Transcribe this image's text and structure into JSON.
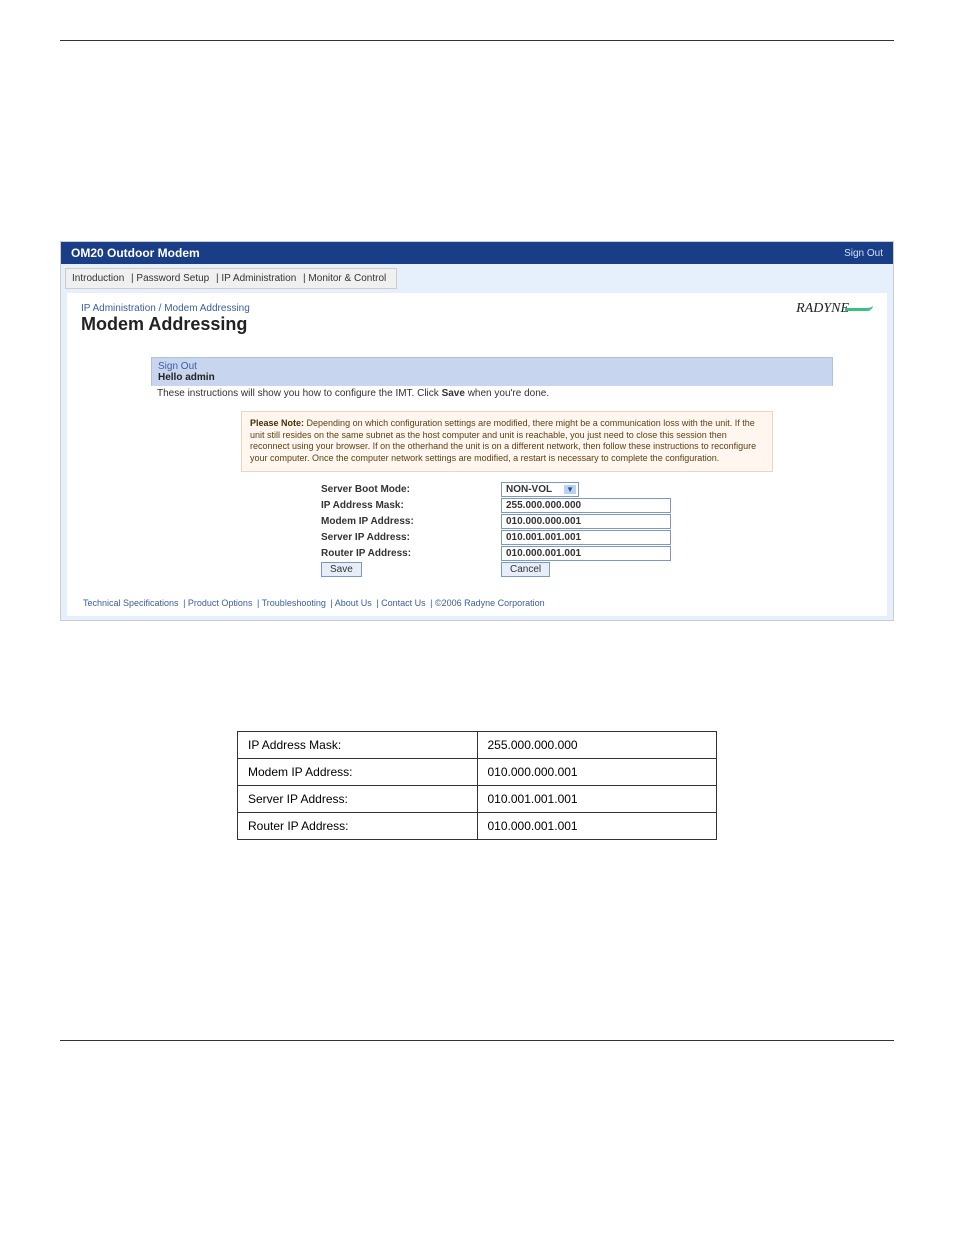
{
  "ss": {
    "title": "OM20 Outdoor Modem",
    "signout_top": "Sign Out",
    "menu": {
      "intro": "Introduction",
      "pw": "Password Setup",
      "ipadmin": "IP Administration",
      "mc": "Monitor & Control"
    },
    "breadcrumb": "IP Administration / Modem Addressing",
    "heading": "Modem Addressing",
    "logo": "RADYNE",
    "signout": "Sign Out",
    "hello": "Hello admin",
    "instructions_pre": "These instructions will show you how to configure the IMT. Click ",
    "instructions_bold": "Save",
    "instructions_post": " when you're done.",
    "note_label": "Please Note:",
    "note_body": " Depending on which configuration settings are modified, there might be a communication loss with the unit. If the unit still resides on the same subnet as the host computer and unit is reachable, you just need to close this session then reconnect using your browser. If on the otherhand the unit is on a different network, then follow these instructions to reconfigure your computer. Once the computer network settings are modified, a restart is necessary to complete the configuration.",
    "labels": {
      "boot": "Server Boot Mode:",
      "mask": "IP Address Mask:",
      "modem": "Modem IP Address:",
      "server": "Server IP Address:",
      "router": "Router IP Address:"
    },
    "values": {
      "boot": "NON-VOL",
      "mask": "255.000.000.000",
      "modem": "010.000.000.001",
      "server": "010.001.001.001",
      "router": "010.000.001.001"
    },
    "buttons": {
      "save": "Save",
      "cancel": "Cancel"
    },
    "footer": {
      "a": "Technical Specifications",
      "b": "Product Options",
      "c": "Troubleshooting",
      "d": "About Us",
      "e": "Contact Us",
      "f": "©2006 Radyne Corporation"
    }
  },
  "table": {
    "r0c0": "IP Address Mask:",
    "r0c1": "255.000.000.000",
    "r1c0": "Modem IP Address:",
    "r1c1": "010.000.000.001",
    "r2c0": "Server IP Address:",
    "r2c1": "010.001.001.001",
    "r3c0": "Router IP Address:",
    "r3c1": "010.000.001.001"
  }
}
